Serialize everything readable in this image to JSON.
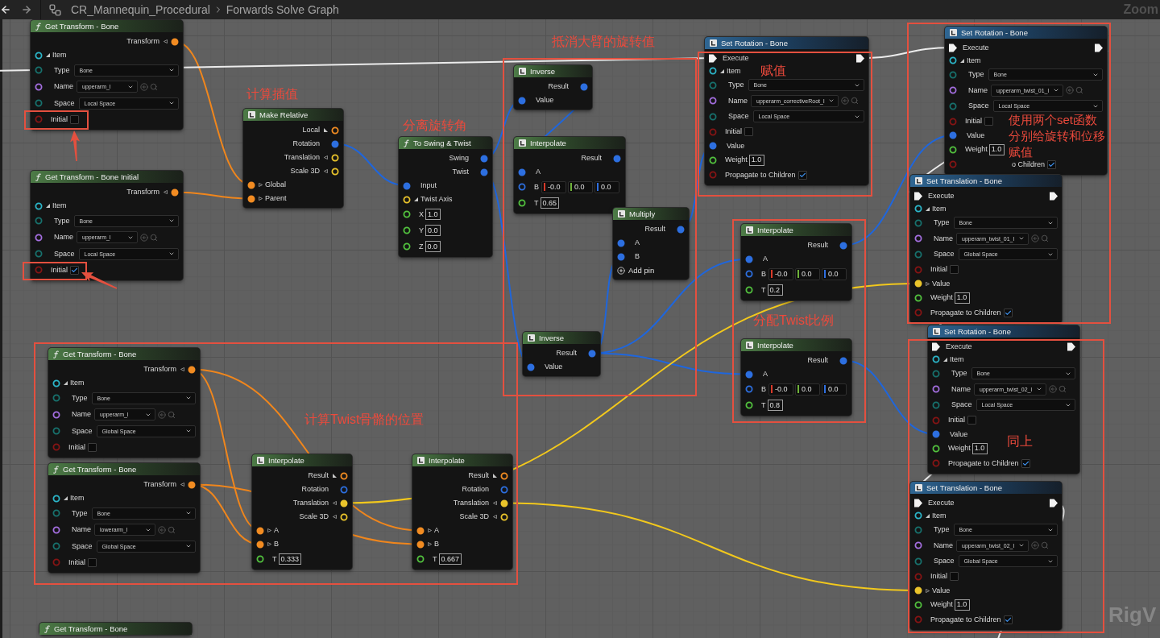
{
  "toolbar": {
    "path": [
      "CR_Mannequin_Procedural",
      "Forwards Solve Graph"
    ],
    "zoom_label": "Zoom"
  },
  "nodes": [
    {
      "title": "Get Transform - Bone",
      "kind": "function",
      "rows": [
        {
          "kind": "output",
          "label": "Transform",
          "color": "#f28c22",
          "connected": true,
          "expanded": false
        },
        {
          "kind": "input",
          "label": "Item",
          "color": "#2bb5c8",
          "connected": false,
          "expanded": true
        },
        {
          "kind": "dropdown",
          "label": "Type",
          "color": "#17716d",
          "value": "Bone"
        },
        {
          "kind": "name",
          "label": "Name",
          "color": "#a46ee0",
          "value": "upperarm_l"
        },
        {
          "kind": "dropdown",
          "label": "Space",
          "color": "#17716d",
          "value": "Local Space"
        },
        {
          "kind": "checkbox",
          "label": "Initial",
          "color": "#861414",
          "checked": false
        }
      ]
    },
    {
      "title": "Get Transform - Bone Initial",
      "kind": "function",
      "rows": [
        {
          "kind": "output",
          "label": "Transform",
          "color": "#f28c22",
          "connected": true,
          "expanded": false
        },
        {
          "kind": "input",
          "label": "Item",
          "color": "#2bb5c8",
          "connected": false,
          "expanded": true
        },
        {
          "kind": "dropdown",
          "label": "Type",
          "color": "#17716d",
          "value": "Bone"
        },
        {
          "kind": "name",
          "label": "Name",
          "color": "#a46ee0",
          "value": "upperarm_l"
        },
        {
          "kind": "dropdown",
          "label": "Space",
          "color": "#17716d",
          "value": "Local Space"
        },
        {
          "kind": "checkbox",
          "label": "Initial",
          "color": "#861414",
          "checked": true
        }
      ]
    },
    {
      "title": "Make Relative",
      "kind": "pure",
      "rows": [
        {
          "kind": "output",
          "label": "Local",
          "color": "#f28c22",
          "connected": false,
          "expanded": true
        },
        {
          "kind": "output",
          "label": "Rotation",
          "color": "#2d6fe0",
          "connected": true
        },
        {
          "kind": "output",
          "label": "Translation",
          "color": "#eac42b",
          "connected": false,
          "expanded": false
        },
        {
          "kind": "output",
          "label": "Scale 3D",
          "color": "#eac42b",
          "connected": false,
          "expanded": false
        },
        {
          "kind": "input",
          "label": "Global",
          "color": "#f28c22",
          "connected": true,
          "expanded": false
        },
        {
          "kind": "input",
          "label": "Parent",
          "color": "#f28c22",
          "connected": true,
          "expanded": false
        }
      ]
    },
    {
      "title": "To Swing & Twist",
      "kind": "function",
      "rows": [
        {
          "kind": "output",
          "label": "Swing",
          "color": "#2d6fe0",
          "connected": true
        },
        {
          "kind": "output",
          "label": "Twist",
          "color": "#2d6fe0",
          "connected": true
        },
        {
          "kind": "input",
          "label": "Input",
          "color": "#2d6fe0",
          "connected": true
        },
        {
          "kind": "input",
          "label": "Twist Axis",
          "color": "#eac42b",
          "connected": false,
          "expanded": true
        },
        {
          "kind": "number",
          "label": "X",
          "color": "#52c23e",
          "value": "1.0"
        },
        {
          "kind": "number",
          "label": "Y",
          "color": "#52c23e",
          "value": "0.0"
        },
        {
          "kind": "number",
          "label": "Z",
          "color": "#52c23e",
          "value": "0.0"
        }
      ]
    },
    {
      "title": "Inverse",
      "kind": "pure",
      "rows": [
        {
          "kind": "output",
          "label": "Result",
          "color": "#2d6fe0",
          "connected": true
        },
        {
          "kind": "input",
          "label": "Value",
          "color": "#2d6fe0",
          "connected": true
        }
      ]
    },
    {
      "title": "Interpolate",
      "kind": "pure",
      "rows": [
        {
          "kind": "output",
          "label": "Result",
          "color": "#2d6fe0",
          "connected": true
        },
        {
          "kind": "input",
          "label": "A",
          "color": "#2d6fe0",
          "connected": true
        },
        {
          "kind": "vector",
          "label": "B",
          "color": "#2d6fe0",
          "values": [
            "-0.0",
            "0.0",
            "0.0"
          ]
        },
        {
          "kind": "number",
          "label": "T",
          "color": "#52c23e",
          "value": "0.65"
        }
      ]
    },
    {
      "title": "Multiply",
      "kind": "pure",
      "rows": [
        {
          "kind": "output",
          "label": "Result",
          "color": "#2d6fe0",
          "connected": true
        },
        {
          "kind": "input",
          "label": "A",
          "color": "#2d6fe0",
          "connected": true
        },
        {
          "kind": "input",
          "label": "B",
          "color": "#2d6fe0",
          "connected": true
        },
        {
          "kind": "add",
          "label": "Add pin"
        }
      ]
    },
    {
      "title": "Inverse",
      "kind": "pure",
      "rows": [
        {
          "kind": "output",
          "label": "Result",
          "color": "#2d6fe0",
          "connected": true
        },
        {
          "kind": "input",
          "label": "Value",
          "color": "#2d6fe0",
          "connected": true
        }
      ]
    },
    {
      "title": "Set Rotation - Bone",
      "kind": "mutable",
      "rows": [
        {
          "kind": "exec",
          "label": "Execute"
        },
        {
          "kind": "input",
          "label": "Item",
          "color": "#2bb5c8",
          "connected": false,
          "expanded": true
        },
        {
          "kind": "dropdown",
          "label": "Type",
          "color": "#17716d",
          "value": "Bone"
        },
        {
          "kind": "name",
          "label": "Name",
          "color": "#a46ee0",
          "value": "upperarm_correctiveRoot_l"
        },
        {
          "kind": "dropdown",
          "label": "Space",
          "color": "#17716d",
          "value": "Local Space"
        },
        {
          "kind": "checkbox",
          "label": "Initial",
          "color": "#861414",
          "checked": false
        },
        {
          "kind": "input",
          "label": "Value",
          "color": "#2d6fe0",
          "connected": true
        },
        {
          "kind": "number",
          "label": "Weight",
          "color": "#52c23e",
          "value": "1.0"
        },
        {
          "kind": "checkbox",
          "label": "Propagate to Children",
          "color": "#861414",
          "checked": true
        }
      ]
    },
    {
      "title": "Set Rotation - Bone",
      "kind": "mutable",
      "rows": [
        {
          "kind": "exec",
          "label": "Execute"
        },
        {
          "kind": "input",
          "label": "Item",
          "color": "#2bb5c8",
          "connected": false,
          "expanded": true
        },
        {
          "kind": "dropdown",
          "label": "Type",
          "color": "#17716d",
          "value": "Bone"
        },
        {
          "kind": "name",
          "label": "Name",
          "color": "#a46ee0",
          "value": "upperarm_twist_01_l"
        },
        {
          "kind": "dropdown",
          "label": "Space",
          "color": "#17716d",
          "value": "Local Space"
        },
        {
          "kind": "checkbox",
          "label": "Initial",
          "color": "#861414",
          "checked": false
        },
        {
          "kind": "input",
          "label": "Value",
          "color": "#2d6fe0",
          "connected": true
        },
        {
          "kind": "number",
          "label": "Weight",
          "color": "#52c23e",
          "value": "1.0"
        },
        {
          "kind": "checkbox",
          "label": "o Children",
          "color": "#861414",
          "checked": true
        }
      ]
    },
    {
      "title": "Set Translation - Bone",
      "kind": "mutable",
      "rows": [
        {
          "kind": "exec",
          "label": "Execute"
        },
        {
          "kind": "input",
          "label": "Item",
          "color": "#2bb5c8",
          "connected": false,
          "expanded": true
        },
        {
          "kind": "dropdown",
          "label": "Type",
          "color": "#17716d",
          "value": "Bone"
        },
        {
          "kind": "name",
          "label": "Name",
          "color": "#a46ee0",
          "value": "upperarm_twist_01_l"
        },
        {
          "kind": "dropdown",
          "label": "Space",
          "color": "#17716d",
          "value": "Global Space"
        },
        {
          "kind": "checkbox",
          "label": "Initial",
          "color": "#861414",
          "checked": false
        },
        {
          "kind": "input",
          "label": "Value",
          "color": "#eac42b",
          "connected": true,
          "expanded": false
        },
        {
          "kind": "number",
          "label": "Weight",
          "color": "#52c23e",
          "value": "1.0"
        },
        {
          "kind": "checkbox",
          "label": "Propagate to Children",
          "color": "#861414",
          "checked": true
        }
      ]
    },
    {
      "title": "Interpolate",
      "kind": "pure",
      "rows": [
        {
          "kind": "output",
          "label": "Result",
          "color": "#2d6fe0",
          "connected": true
        },
        {
          "kind": "input",
          "label": "A",
          "color": "#2d6fe0",
          "connected": true
        },
        {
          "kind": "vector",
          "label": "B",
          "color": "#2d6fe0",
          "values": [
            "-0.0",
            "0.0",
            "0.0"
          ]
        },
        {
          "kind": "number",
          "label": "T",
          "color": "#52c23e",
          "value": "0.2"
        }
      ]
    },
    {
      "title": "Interpolate",
      "kind": "pure",
      "rows": [
        {
          "kind": "output",
          "label": "Result",
          "color": "#2d6fe0",
          "connected": true
        },
        {
          "kind": "input",
          "label": "A",
          "color": "#2d6fe0",
          "connected": true
        },
        {
          "kind": "vector",
          "label": "B",
          "color": "#2d6fe0",
          "values": [
            "-0.0",
            "0.0",
            "0.0"
          ]
        },
        {
          "kind": "number",
          "label": "T",
          "color": "#52c23e",
          "value": "0.8"
        }
      ]
    },
    {
      "title": "Set Rotation - Bone",
      "kind": "mutable",
      "rows": [
        {
          "kind": "exec",
          "label": "Execute"
        },
        {
          "kind": "input",
          "label": "Item",
          "color": "#2bb5c8",
          "connected": false,
          "expanded": true
        },
        {
          "kind": "dropdown",
          "label": "Type",
          "color": "#17716d",
          "value": "Bone"
        },
        {
          "kind": "name",
          "label": "Name",
          "color": "#a46ee0",
          "value": "upperarm_twist_02_l"
        },
        {
          "kind": "dropdown",
          "label": "Space",
          "color": "#17716d",
          "value": "Local Space"
        },
        {
          "kind": "checkbox",
          "label": "Initial",
          "color": "#861414",
          "checked": false
        },
        {
          "kind": "input",
          "label": "Value",
          "color": "#2d6fe0",
          "connected": true
        },
        {
          "kind": "number",
          "label": "Weight",
          "color": "#52c23e",
          "value": "1.0"
        },
        {
          "kind": "checkbox",
          "label": "Propagate to Children",
          "color": "#861414",
          "checked": true
        }
      ]
    },
    {
      "title": "Set Translation - Bone",
      "kind": "mutable",
      "rows": [
        {
          "kind": "exec",
          "label": "Execute"
        },
        {
          "kind": "input",
          "label": "Item",
          "color": "#2bb5c8",
          "connected": false,
          "expanded": true
        },
        {
          "kind": "dropdown",
          "label": "Type",
          "color": "#17716d",
          "value": "Bone"
        },
        {
          "kind": "name",
          "label": "Name",
          "color": "#a46ee0",
          "value": "upperarm_twist_02_l"
        },
        {
          "kind": "dropdown",
          "label": "Space",
          "color": "#17716d",
          "value": "Global Space"
        },
        {
          "kind": "checkbox",
          "label": "Initial",
          "color": "#861414",
          "checked": false
        },
        {
          "kind": "input",
          "label": "Value",
          "color": "#eac42b",
          "connected": true,
          "expanded": false
        },
        {
          "kind": "number",
          "label": "Weight",
          "color": "#52c23e",
          "value": "1.0"
        },
        {
          "kind": "checkbox",
          "label": "Propagate to Children",
          "color": "#861414",
          "checked": true
        }
      ]
    },
    {
      "title": "Get Transform - Bone",
      "kind": "function",
      "rows": [
        {
          "kind": "output",
          "label": "Transform",
          "color": "#f28c22",
          "connected": true,
          "expanded": false
        },
        {
          "kind": "input",
          "label": "Item",
          "color": "#2bb5c8",
          "connected": false,
          "expanded": true
        },
        {
          "kind": "dropdown",
          "label": "Type",
          "color": "#17716d",
          "value": "Bone"
        },
        {
          "kind": "name",
          "label": "Name",
          "color": "#a46ee0",
          "value": "upperarm_l"
        },
        {
          "kind": "dropdown",
          "label": "Space",
          "color": "#17716d",
          "value": "Global Space"
        },
        {
          "kind": "checkbox",
          "label": "Initial",
          "color": "#861414",
          "checked": false
        }
      ]
    },
    {
      "title": "Get Transform - Bone",
      "kind": "function",
      "rows": [
        {
          "kind": "output",
          "label": "Transform",
          "color": "#f28c22",
          "connected": true,
          "expanded": false
        },
        {
          "kind": "input",
          "label": "Item",
          "color": "#2bb5c8",
          "connected": false,
          "expanded": true
        },
        {
          "kind": "dropdown",
          "label": "Type",
          "color": "#17716d",
          "value": "Bone"
        },
        {
          "kind": "name",
          "label": "Name",
          "color": "#a46ee0",
          "value": "lowerarm_l"
        },
        {
          "kind": "dropdown",
          "label": "Space",
          "color": "#17716d",
          "value": "Global Space"
        },
        {
          "kind": "checkbox",
          "label": "Initial",
          "color": "#861414",
          "checked": false
        }
      ]
    },
    {
      "title": "Interpolate",
      "kind": "pure",
      "rows": [
        {
          "kind": "output",
          "label": "Result",
          "color": "#f28c22",
          "connected": false,
          "expanded": true
        },
        {
          "kind": "output",
          "label": "Rotation",
          "color": "#2d6fe0",
          "connected": false
        },
        {
          "kind": "output",
          "label": "Translation",
          "color": "#eac42b",
          "connected": true,
          "expanded": false
        },
        {
          "kind": "output",
          "label": "Scale 3D",
          "color": "#eac42b",
          "connected": false,
          "expanded": false
        },
        {
          "kind": "input",
          "label": "A",
          "color": "#f28c22",
          "connected": true,
          "expanded": false
        },
        {
          "kind": "input",
          "label": "B",
          "color": "#f28c22",
          "connected": true,
          "expanded": false
        },
        {
          "kind": "number",
          "label": "T",
          "color": "#52c23e",
          "value": "0.333"
        }
      ]
    },
    {
      "title": "Interpolate",
      "kind": "pure",
      "rows": [
        {
          "kind": "output",
          "label": "Result",
          "color": "#f28c22",
          "connected": false,
          "expanded": true
        },
        {
          "kind": "output",
          "label": "Rotation",
          "color": "#2d6fe0",
          "connected": false
        },
        {
          "kind": "output",
          "label": "Translation",
          "color": "#eac42b",
          "connected": true,
          "expanded": false
        },
        {
          "kind": "output",
          "label": "Scale 3D",
          "color": "#eac42b",
          "connected": false,
          "expanded": false
        },
        {
          "kind": "input",
          "label": "A",
          "color": "#f28c22",
          "connected": true,
          "expanded": false
        },
        {
          "kind": "input",
          "label": "B",
          "color": "#f28c22",
          "connected": true,
          "expanded": false
        },
        {
          "kind": "number",
          "label": "T",
          "color": "#52c23e",
          "value": "0.667"
        }
      ]
    },
    {
      "title": "Get Transform - Bone",
      "kind": "function"
    }
  ],
  "annotations": [
    {
      "text": "抵消大臂的旋转值"
    },
    {
      "text": "赋值"
    },
    {
      "text": "计算插值"
    },
    {
      "text": "分离旋转角"
    },
    {
      "text": "使用两个set函数分别给旋转和位移赋值"
    },
    {
      "text": "分配Twist比例"
    },
    {
      "text": "计算Twist骨骼的位置"
    },
    {
      "text": "同上"
    }
  ],
  "canvas": {
    "graph_label": "RigV"
  }
}
